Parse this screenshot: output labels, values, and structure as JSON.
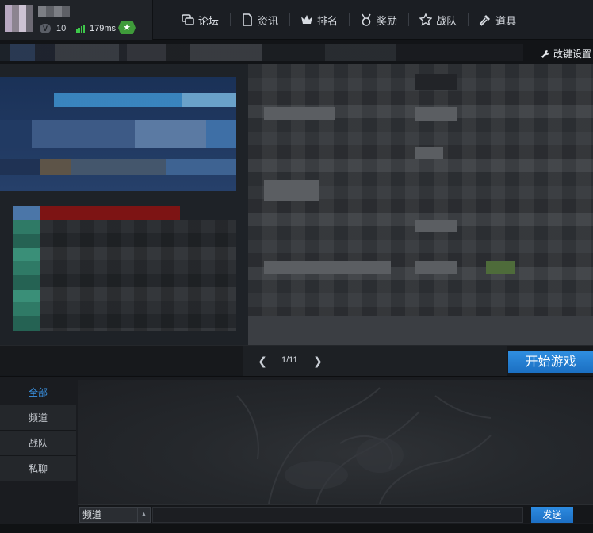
{
  "user": {
    "level": "10",
    "ping": "179ms",
    "icons": {
      "level": "level-icon",
      "signal": "signal-icon",
      "badge": "star-badge-icon"
    }
  },
  "nav": {
    "items": [
      {
        "label": "论坛",
        "icon": "forum-icon"
      },
      {
        "label": "资讯",
        "icon": "news-icon"
      },
      {
        "label": "排名",
        "icon": "crown-icon"
      },
      {
        "label": "奖励",
        "icon": "medal-icon"
      },
      {
        "label": "战队",
        "icon": "star-icon"
      },
      {
        "label": "道具",
        "icon": "hammer-icon"
      }
    ]
  },
  "banner": {
    "key_settings_label": "改键设置",
    "key_settings_icon": "wrench-icon"
  },
  "carousel": {
    "page": "1/11",
    "prev_icon": "chevron-left-icon",
    "next_icon": "chevron-right-icon",
    "start_label": "开始游戏"
  },
  "chat": {
    "tabs": [
      {
        "label": "全部",
        "active": true
      },
      {
        "label": "频道",
        "active": false
      },
      {
        "label": "战队",
        "active": false
      },
      {
        "label": "私聊",
        "active": false
      }
    ],
    "channel_value": "频道",
    "input_value": "",
    "send_label": "发送"
  },
  "colors": {
    "accent": "#2f8ee0",
    "active_tab_text": "#3a95e8",
    "ping_green": "#3ec84a"
  }
}
